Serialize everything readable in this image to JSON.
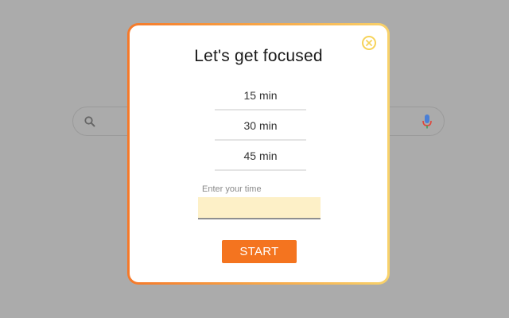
{
  "background": {
    "search_icon": "search-icon",
    "mic_icon": "mic-icon"
  },
  "modal": {
    "title": "Let's get focused",
    "close_icon": "close-icon",
    "options": [
      {
        "label": "15 min"
      },
      {
        "label": "30 min"
      },
      {
        "label": "45 min"
      }
    ],
    "custom_time": {
      "label": "Enter your time",
      "value": "",
      "placeholder": ""
    },
    "start_label": "START"
  },
  "colors": {
    "accent": "#f4741f",
    "border_gradient_start": "#f5792a",
    "border_gradient_end": "#f8d26b",
    "input_bg": "#fdf0c7",
    "close_ring": "#f6d35a"
  }
}
